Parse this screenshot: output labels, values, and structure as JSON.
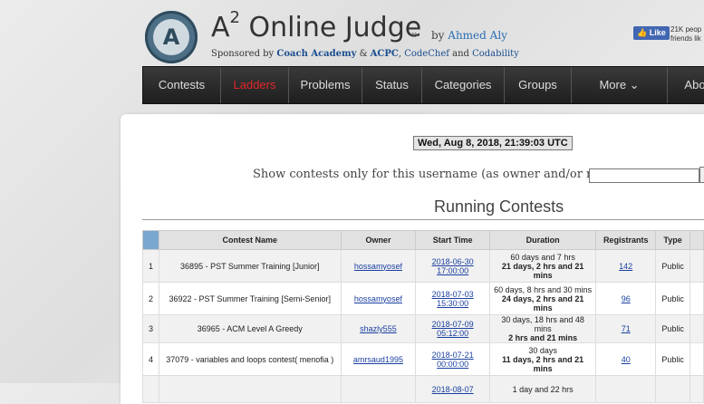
{
  "header": {
    "logo_letter": "A",
    "title_prefix": "A",
    "title_sup": "2",
    "title_rest": " Online Judge",
    "raquo": "»",
    "by_text": "by ",
    "author": "Ahmed Aly",
    "sponsor_prefix": "Sponsored by ",
    "sponsor_1": "Coach Academy",
    "sponsor_amp": " & ",
    "sponsor_2": "ACPC",
    "sponsor_comma": ", ",
    "sponsor_3": "CodeChef",
    "sponsor_and": " and ",
    "sponsor_4": "Codability",
    "fb_like": "Like",
    "fb_count_line1": "21K peop",
    "fb_count_line2": "friends lik"
  },
  "nav": {
    "items": [
      "Contests",
      "Ladders",
      "Problems",
      "Status",
      "Categories",
      "Groups",
      "More ⌄",
      "Abo"
    ],
    "active_index": 1,
    "active_color": "#e0262a"
  },
  "main": {
    "date": "Wed, Aug 8, 2018, 21:39:03 UTC",
    "show_label": "Show contests only for this username (as owner and/or registrant):",
    "username_value": "",
    "section_title": "Running Contests"
  },
  "table": {
    "headers": [
      "",
      "Contest Name",
      "Owner",
      "Start Time",
      "Duration",
      "Registrants",
      "Type",
      ""
    ],
    "rows": [
      {
        "num": "1",
        "name": "36895 - PST Summer Training [Junior]",
        "owner": "hossamyosef",
        "start_1": "2018-06-30",
        "start_2": "17:00:00",
        "dur_1": "60 days and 7 hrs",
        "dur_2": "21 days, 2 hrs and 21",
        "dur_3": "mins",
        "registrants": "142",
        "type": "Public"
      },
      {
        "num": "2",
        "name": "36922 - PST Summer Training [Semi-Senior]",
        "owner": "hossamyosef",
        "start_1": "2018-07-03",
        "start_2": "15:30:00",
        "dur_1": "60 days, 8 hrs and 30 mins",
        "dur_2": "24 days, 2 hrs and 21",
        "dur_3": "mins",
        "registrants": "96",
        "type": "Public"
      },
      {
        "num": "3",
        "name": "36965 - ACM Level A Greedy",
        "owner": "shazly555",
        "start_1": "2018-07-09",
        "start_2": "05:12:00",
        "dur_1": "30 days, 18 hrs and 48 mins",
        "dur_2": "2 hrs and 21 mins",
        "dur_3": "",
        "registrants": "71",
        "type": "Public"
      },
      {
        "num": "4",
        "name": "37079 - variables and loops contest( menofia )",
        "owner": "amrsaud1995",
        "start_1": "2018-07-21",
        "start_2": "00:00:00",
        "dur_1": "30 days",
        "dur_2": "11 days, 2 hrs and 21",
        "dur_3": "mins",
        "registrants": "40",
        "type": "Public"
      },
      {
        "num": "",
        "name": "",
        "owner": "",
        "start_1": "2018-08-07",
        "start_2": "",
        "dur_1": "1 day and 22 hrs",
        "dur_2": "",
        "dur_3": "",
        "registrants": "",
        "type": ""
      }
    ]
  }
}
